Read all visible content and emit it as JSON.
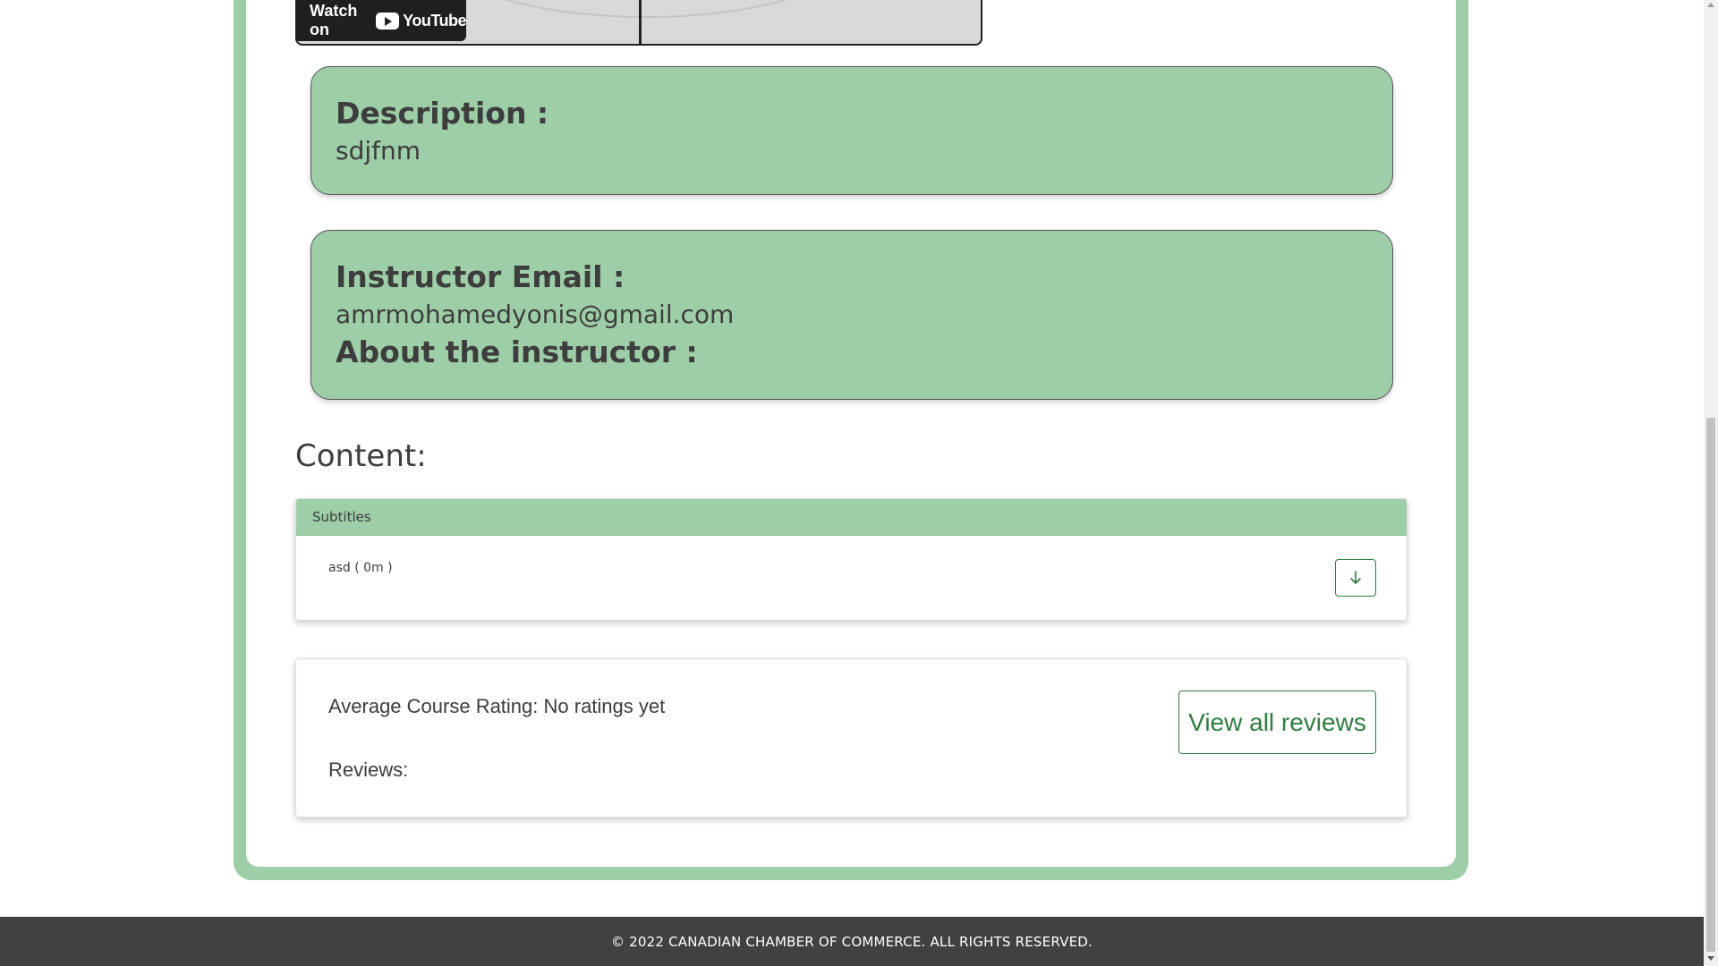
{
  "video": {
    "watch_on": "Watch on",
    "platform": "YouTube"
  },
  "description": {
    "label": "Description :",
    "value": "sdjfnm"
  },
  "instructor": {
    "email_label": "Instructor Email :",
    "email_value": "amrmohamedyonis@gmail.com",
    "about_label": "About the instructor :"
  },
  "content": {
    "heading": "Content:",
    "section_title": "Subtitles",
    "items": [
      {
        "label": "asd ( 0m )",
        "icon": "download-arrow-icon"
      }
    ]
  },
  "ratings": {
    "average": "Average Course Rating: No ratings yet",
    "reviews_label": "Reviews:",
    "view_all_label": "View all reviews"
  },
  "footer": {
    "copyright": "© 2022 CANADIAN CHAMBER OF COMMERCE. ALL RIGHTS RESERVED."
  },
  "colors": {
    "accent_green": "#9dcea8",
    "button_green": "#2e7d3f",
    "footer_bg": "#414141"
  }
}
